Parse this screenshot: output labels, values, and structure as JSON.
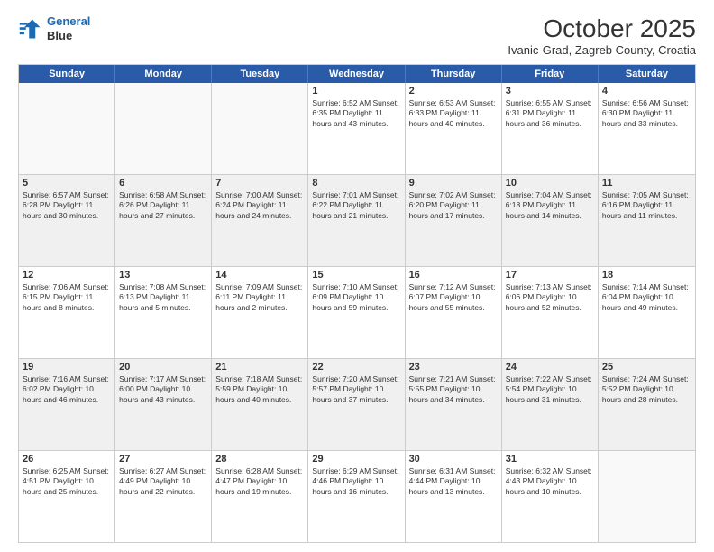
{
  "header": {
    "logo_line1": "General",
    "logo_line2": "Blue",
    "month": "October 2025",
    "location": "Ivanic-Grad, Zagreb County, Croatia"
  },
  "days_of_week": [
    "Sunday",
    "Monday",
    "Tuesday",
    "Wednesday",
    "Thursday",
    "Friday",
    "Saturday"
  ],
  "weeks": [
    [
      {
        "day": "",
        "empty": true
      },
      {
        "day": "",
        "empty": true
      },
      {
        "day": "",
        "empty": true
      },
      {
        "day": "1",
        "text": "Sunrise: 6:52 AM\nSunset: 6:35 PM\nDaylight: 11 hours and 43 minutes."
      },
      {
        "day": "2",
        "text": "Sunrise: 6:53 AM\nSunset: 6:33 PM\nDaylight: 11 hours and 40 minutes."
      },
      {
        "day": "3",
        "text": "Sunrise: 6:55 AM\nSunset: 6:31 PM\nDaylight: 11 hours and 36 minutes."
      },
      {
        "day": "4",
        "text": "Sunrise: 6:56 AM\nSunset: 6:30 PM\nDaylight: 11 hours and 33 minutes."
      }
    ],
    [
      {
        "day": "5",
        "text": "Sunrise: 6:57 AM\nSunset: 6:28 PM\nDaylight: 11 hours and 30 minutes."
      },
      {
        "day": "6",
        "text": "Sunrise: 6:58 AM\nSunset: 6:26 PM\nDaylight: 11 hours and 27 minutes."
      },
      {
        "day": "7",
        "text": "Sunrise: 7:00 AM\nSunset: 6:24 PM\nDaylight: 11 hours and 24 minutes."
      },
      {
        "day": "8",
        "text": "Sunrise: 7:01 AM\nSunset: 6:22 PM\nDaylight: 11 hours and 21 minutes."
      },
      {
        "day": "9",
        "text": "Sunrise: 7:02 AM\nSunset: 6:20 PM\nDaylight: 11 hours and 17 minutes."
      },
      {
        "day": "10",
        "text": "Sunrise: 7:04 AM\nSunset: 6:18 PM\nDaylight: 11 hours and 14 minutes."
      },
      {
        "day": "11",
        "text": "Sunrise: 7:05 AM\nSunset: 6:16 PM\nDaylight: 11 hours and 11 minutes."
      }
    ],
    [
      {
        "day": "12",
        "text": "Sunrise: 7:06 AM\nSunset: 6:15 PM\nDaylight: 11 hours and 8 minutes."
      },
      {
        "day": "13",
        "text": "Sunrise: 7:08 AM\nSunset: 6:13 PM\nDaylight: 11 hours and 5 minutes."
      },
      {
        "day": "14",
        "text": "Sunrise: 7:09 AM\nSunset: 6:11 PM\nDaylight: 11 hours and 2 minutes."
      },
      {
        "day": "15",
        "text": "Sunrise: 7:10 AM\nSunset: 6:09 PM\nDaylight: 10 hours and 59 minutes."
      },
      {
        "day": "16",
        "text": "Sunrise: 7:12 AM\nSunset: 6:07 PM\nDaylight: 10 hours and 55 minutes."
      },
      {
        "day": "17",
        "text": "Sunrise: 7:13 AM\nSunset: 6:06 PM\nDaylight: 10 hours and 52 minutes."
      },
      {
        "day": "18",
        "text": "Sunrise: 7:14 AM\nSunset: 6:04 PM\nDaylight: 10 hours and 49 minutes."
      }
    ],
    [
      {
        "day": "19",
        "text": "Sunrise: 7:16 AM\nSunset: 6:02 PM\nDaylight: 10 hours and 46 minutes."
      },
      {
        "day": "20",
        "text": "Sunrise: 7:17 AM\nSunset: 6:00 PM\nDaylight: 10 hours and 43 minutes."
      },
      {
        "day": "21",
        "text": "Sunrise: 7:18 AM\nSunset: 5:59 PM\nDaylight: 10 hours and 40 minutes."
      },
      {
        "day": "22",
        "text": "Sunrise: 7:20 AM\nSunset: 5:57 PM\nDaylight: 10 hours and 37 minutes."
      },
      {
        "day": "23",
        "text": "Sunrise: 7:21 AM\nSunset: 5:55 PM\nDaylight: 10 hours and 34 minutes."
      },
      {
        "day": "24",
        "text": "Sunrise: 7:22 AM\nSunset: 5:54 PM\nDaylight: 10 hours and 31 minutes."
      },
      {
        "day": "25",
        "text": "Sunrise: 7:24 AM\nSunset: 5:52 PM\nDaylight: 10 hours and 28 minutes."
      }
    ],
    [
      {
        "day": "26",
        "text": "Sunrise: 6:25 AM\nSunset: 4:51 PM\nDaylight: 10 hours and 25 minutes."
      },
      {
        "day": "27",
        "text": "Sunrise: 6:27 AM\nSunset: 4:49 PM\nDaylight: 10 hours and 22 minutes."
      },
      {
        "day": "28",
        "text": "Sunrise: 6:28 AM\nSunset: 4:47 PM\nDaylight: 10 hours and 19 minutes."
      },
      {
        "day": "29",
        "text": "Sunrise: 6:29 AM\nSunset: 4:46 PM\nDaylight: 10 hours and 16 minutes."
      },
      {
        "day": "30",
        "text": "Sunrise: 6:31 AM\nSunset: 4:44 PM\nDaylight: 10 hours and 13 minutes."
      },
      {
        "day": "31",
        "text": "Sunrise: 6:32 AM\nSunset: 4:43 PM\nDaylight: 10 hours and 10 minutes."
      },
      {
        "day": "",
        "empty": true
      }
    ]
  ]
}
